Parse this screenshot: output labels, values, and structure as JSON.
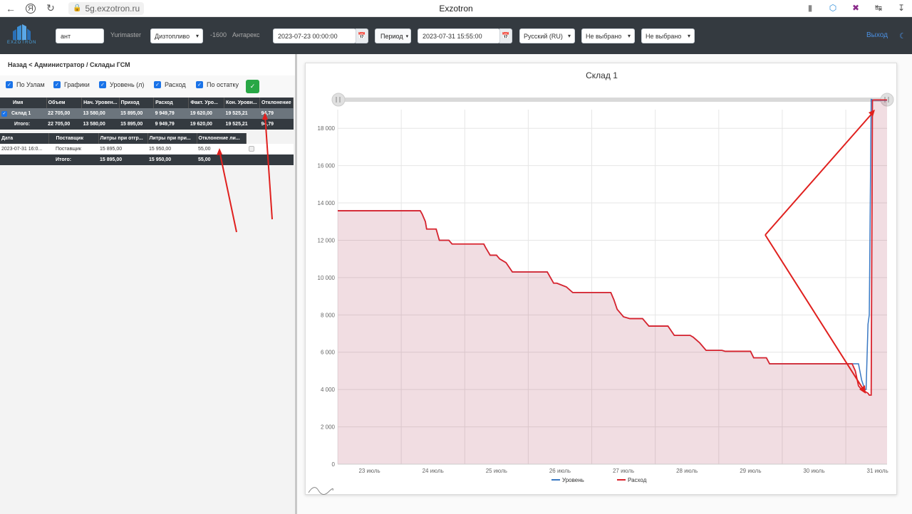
{
  "browser": {
    "url": "5g.exzotron.ru",
    "title": "Exzotron"
  },
  "navbar": {
    "logo_text": "EXZOTRON",
    "search_value": "ант",
    "user": "Yurimaster",
    "fuel_select": "Дизтопливо",
    "offset": "-1600",
    "company": "Антарекс",
    "date_from": "2023-07-23 00:00:00",
    "period_label": "Период",
    "date_to": "2023-07-31 15:55:00",
    "language": "Русский (RU)",
    "filter1": "Не выбрано",
    "filter2": "Не выбрано",
    "logout": "Выход"
  },
  "left": {
    "breadcrumb": "Назад < Администратор / Склады ГСМ",
    "checks": [
      "По Узлам",
      "Графики",
      "Уровень (л)",
      "Расход",
      "По остатку"
    ],
    "table1": {
      "headers": [
        "Имя",
        "Объем",
        "Нач. Уровен...",
        "Приход",
        "Расход",
        "Факт. Уро...",
        "Кон. Уровн...",
        "Отклонение"
      ],
      "rows": [
        [
          "Склад 1",
          "22 705,00",
          "13 580,00",
          "15 895,00",
          "9 949,79",
          "19 620,00",
          "19 525,21",
          "94,79"
        ]
      ],
      "total": [
        "Итого:",
        "22 705,00",
        "13 580,00",
        "15 895,00",
        "9 949,79",
        "19 620,00",
        "19 525,21",
        "94,79"
      ]
    },
    "table2": {
      "headers": [
        "Дата",
        "Поставщик",
        "Литры при отгр...",
        "Литры при при...",
        "Отклонение ли..."
      ],
      "rows": [
        [
          "2023-07-31 16:0...",
          "Поставщик",
          "15 895,00",
          "15 950,00",
          "55,00"
        ]
      ],
      "total": [
        "",
        "Итого:",
        "15 895,00",
        "15 950,00",
        "55,00"
      ]
    }
  },
  "chart_data": {
    "type": "area",
    "title": "Склад 1",
    "xlabel": "",
    "ylabel": "",
    "categories": [
      "23 июль",
      "24 июль",
      "25 июль",
      "26 июль",
      "27 июль",
      "28 июль",
      "29 июль",
      "30 июль",
      "31 июль"
    ],
    "xlim": [
      0,
      8.65
    ],
    "ylim": [
      0,
      19000
    ],
    "yticks": [
      "0",
      "2 000",
      "4 000",
      "6 000",
      "8 000",
      "10 000",
      "12 000",
      "14 000",
      "16 000",
      "18 000"
    ],
    "grid": true,
    "legend_position": "bottom",
    "series": [
      {
        "name": "Уровень",
        "color": "#3a78c3",
        "x": [
          0,
          1.3,
          1.33,
          1.38,
          1.4,
          1.55,
          1.6,
          1.75,
          1.8,
          2.3,
          2.33,
          2.4,
          2.5,
          2.55,
          2.65,
          2.75,
          2.9,
          3.3,
          3.35,
          3.4,
          3.45,
          3.6,
          3.7,
          4.3,
          4.35,
          4.4,
          4.5,
          4.6,
          4.8,
          4.9,
          5.2,
          5.3,
          5.55,
          5.6,
          5.7,
          5.8,
          6.05,
          6.1,
          6.5,
          6.55,
          6.75,
          6.8,
          8.2,
          8.25,
          8.3,
          8.32,
          8.35,
          8.37,
          8.4,
          8.45,
          8.65
        ],
        "values": [
          13580,
          13580,
          13400,
          13000,
          12600,
          12600,
          12000,
          12000,
          11800,
          11800,
          11600,
          11200,
          11200,
          11000,
          10800,
          10300,
          10300,
          10300,
          10000,
          9700,
          9700,
          9500,
          9200,
          9200,
          8800,
          8300,
          7900,
          7800,
          7800,
          7400,
          7400,
          6900,
          6900,
          6800,
          6500,
          6100,
          6100,
          6050,
          6050,
          5700,
          5700,
          5380,
          5380,
          4500,
          4000,
          4000,
          7500,
          8000,
          19550,
          19500,
          19500
        ]
      },
      {
        "name": "Расход",
        "color": "#d9232d",
        "x": [
          0,
          1.3,
          1.33,
          1.38,
          1.4,
          1.55,
          1.6,
          1.75,
          1.8,
          2.3,
          2.33,
          2.4,
          2.5,
          2.55,
          2.65,
          2.75,
          2.9,
          3.3,
          3.35,
          3.4,
          3.45,
          3.6,
          3.7,
          4.3,
          4.35,
          4.4,
          4.5,
          4.6,
          4.8,
          4.9,
          5.2,
          5.3,
          5.55,
          5.6,
          5.7,
          5.8,
          6.05,
          6.1,
          6.5,
          6.55,
          6.75,
          6.8,
          8.1,
          8.15,
          8.2,
          8.25,
          8.3,
          8.35,
          8.37,
          8.4,
          8.42,
          8.44,
          8.65
        ],
        "values": [
          13580,
          13580,
          13400,
          13000,
          12600,
          12600,
          12000,
          12000,
          11800,
          11800,
          11600,
          11200,
          11200,
          11000,
          10800,
          10300,
          10300,
          10300,
          10000,
          9700,
          9700,
          9500,
          9200,
          9200,
          8800,
          8300,
          7900,
          7800,
          7800,
          7400,
          7400,
          6900,
          6900,
          6800,
          6500,
          6100,
          6100,
          6050,
          6050,
          5700,
          5700,
          5380,
          5380,
          5000,
          4200,
          4000,
          3900,
          3800,
          3700,
          3700,
          19500,
          19520,
          19520
        ]
      }
    ]
  }
}
